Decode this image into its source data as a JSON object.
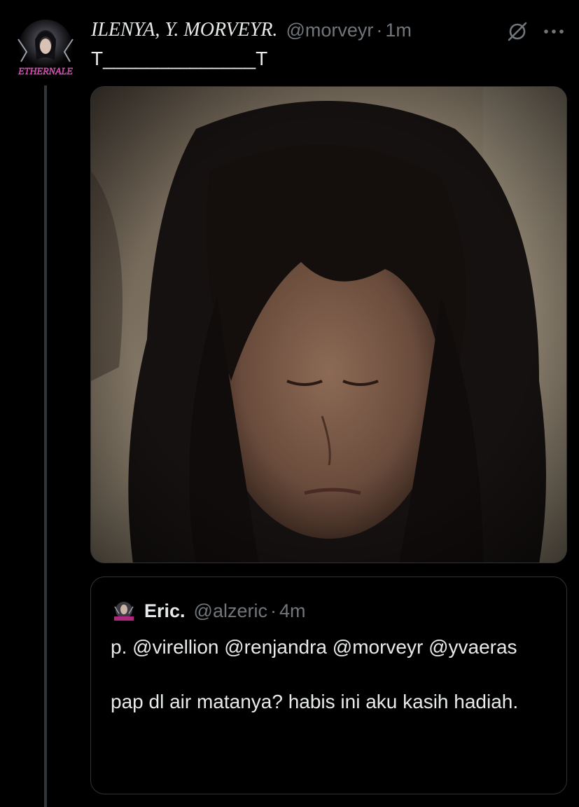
{
  "tweet": {
    "display_name": "ILENYA, Y. MORVEYR.",
    "handle": "@morveyr",
    "separator": "·",
    "time": "1m",
    "text": "T______________T",
    "avatar_label": "ETHERNALE",
    "icons": {
      "reply_restricted": "no-entry-icon",
      "more": "more-icon"
    }
  },
  "quote": {
    "display_name": "Eric.",
    "handle": "@alzeric",
    "separator": "·",
    "time": "4m",
    "paragraphs": [
      "p. @virellion @renjandra @morveyr @yvaeras",
      "pap dl air matanya? habis ini aku kasih hadiah."
    ]
  },
  "colors": {
    "background": "#000000",
    "text_primary": "#e7e9ea",
    "text_secondary": "#71767b",
    "border": "#2f3336",
    "thread_line": "#333639"
  }
}
